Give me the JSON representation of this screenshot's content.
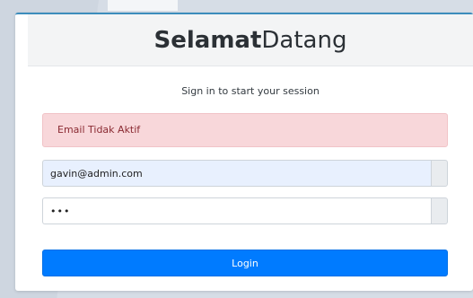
{
  "header": {
    "title_bold": "Selamat",
    "title_light": "Datang"
  },
  "subtitle": "Sign in to start your session",
  "alert": {
    "message": "Email Tidak Aktif"
  },
  "form": {
    "email_value": "gavin@admin.com",
    "password_value": "•••"
  },
  "login_button": {
    "label": "Login"
  },
  "colors": {
    "primary": "#007bff",
    "alert_bg": "#f8d7da",
    "alert_text": "#8a2a32",
    "autofill_bg": "#e8f0fe"
  }
}
